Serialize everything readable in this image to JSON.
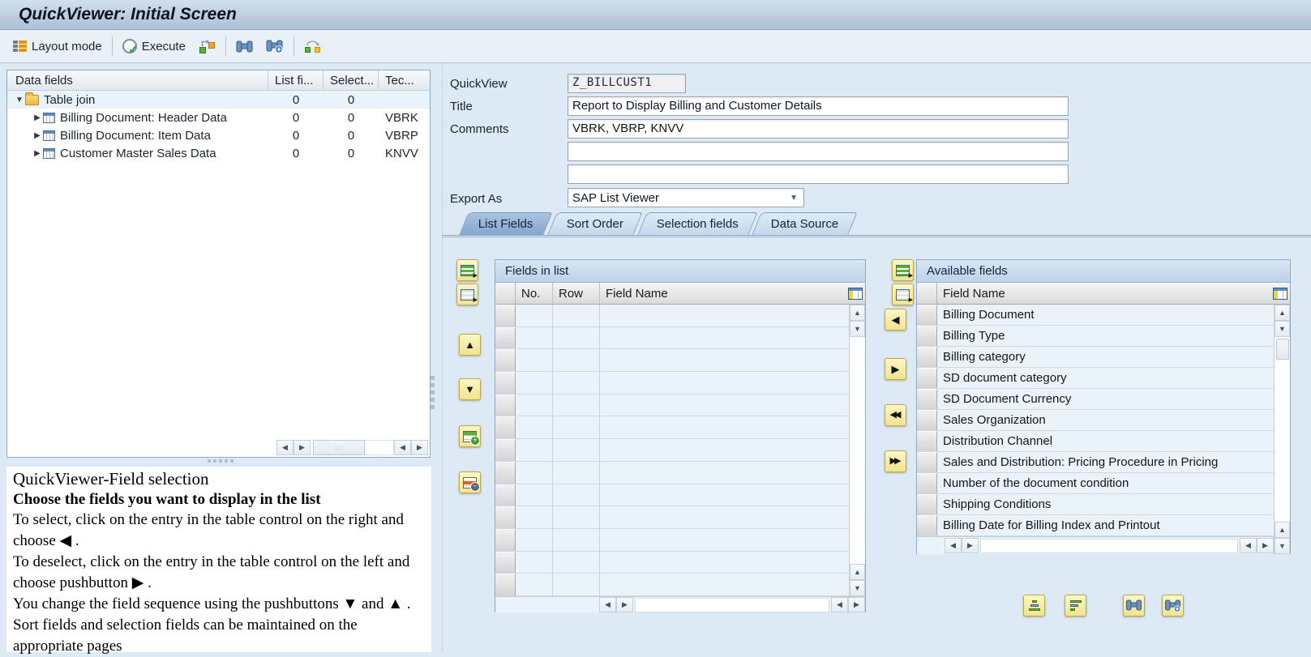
{
  "window": {
    "title": "QuickViewer: Initial Screen"
  },
  "toolbar": {
    "layout_mode": "Layout mode",
    "execute": "Execute"
  },
  "icons": {
    "expanded": "▼",
    "collapsed": "▶",
    "up": "▲",
    "down": "▼",
    "left": "◀",
    "right": "▶",
    "double_left": "◀◀",
    "double_right": "▶▶",
    "dropdown": "▼",
    "thumb_dots": ":::"
  },
  "tree": {
    "header": {
      "name": "Data fields",
      "list_fields": "List fi...",
      "selection": "Select...",
      "table": "Tec..."
    },
    "rows": [
      {
        "label": "Table join",
        "list_fields": "0",
        "selection": "0",
        "table": "",
        "level": 0,
        "expanded": true,
        "icon": "folder"
      },
      {
        "label": "Billing Document: Header Data",
        "list_fields": "0",
        "selection": "0",
        "table": "VBRK",
        "level": 1,
        "expanded": false,
        "icon": "table"
      },
      {
        "label": "Billing Document: Item Data",
        "list_fields": "0",
        "selection": "0",
        "table": "VBRP",
        "level": 1,
        "expanded": false,
        "icon": "table"
      },
      {
        "label": "Customer Master Sales Data",
        "list_fields": "0",
        "selection": "0",
        "table": "KNVV",
        "level": 1,
        "expanded": false,
        "icon": "table"
      }
    ]
  },
  "form": {
    "quickview_label": "QuickView",
    "quickview_value": "Z_BILLCUST1",
    "title_label": "Title",
    "title_value": "Report to Display Billing and Customer Details",
    "comments_label": "Comments",
    "comments_value": "VBRK, VBRP, KNVV",
    "extra_line1": "",
    "extra_line2": "",
    "export_as_label": "Export As",
    "export_as_value": "SAP List Viewer"
  },
  "tabs": [
    {
      "label": "List Fields",
      "active": true
    },
    {
      "label": "Sort Order",
      "active": false
    },
    {
      "label": "Selection fields",
      "active": false
    },
    {
      "label": "Data Source",
      "active": false
    }
  ],
  "fields_in_list": {
    "title": "Fields in list",
    "col_no": "No.",
    "col_row": "Row",
    "col_field": "Field Name",
    "empty_row_count": 13
  },
  "available_fields": {
    "title": "Available fields",
    "col_field": "Field Name",
    "rows": [
      "Billing Document",
      "Billing Type",
      "Billing category",
      "SD document category",
      "SD Document Currency",
      "Sales Organization",
      "Distribution Channel",
      "Sales and Distribution: Pricing Procedure in Pricing",
      "Number of the document condition",
      "Shipping Conditions",
      "Billing Date for Billing Index and Printout"
    ]
  },
  "help": {
    "heading": "QuickViewer-Field selection",
    "subheading": "Choose the fields you want to display in the list",
    "lines": [
      "To select, click on the entry in the table control on the right and choose ◀ .",
      "To deselect, click on the entry in the table control on the left and choose pushbutton ▶ .",
      "You change the field sequence using the pushbuttons ▼ and ▲ .",
      "Sort fields and selection fields can be maintained on the appropriate pages"
    ]
  }
}
